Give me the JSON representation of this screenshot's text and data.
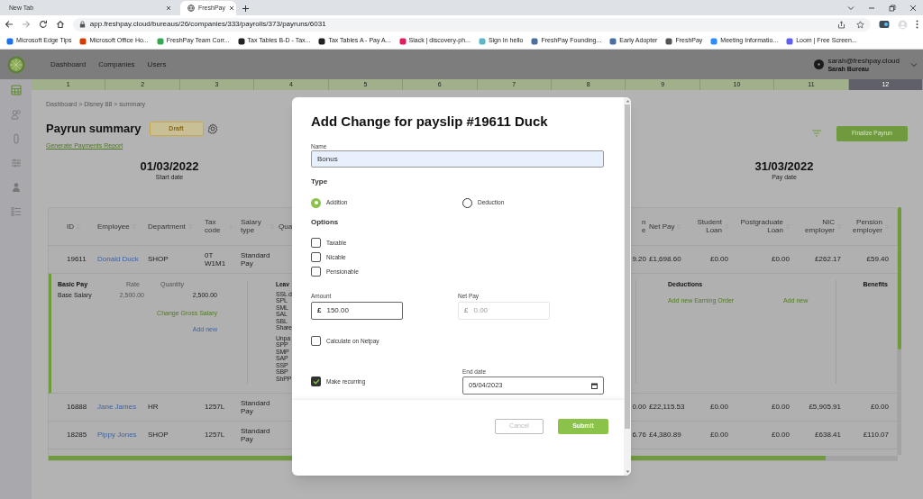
{
  "browser": {
    "tabs": [
      {
        "title": "New Tab",
        "selected": false
      },
      {
        "title": "FreshPay",
        "selected": true
      }
    ],
    "url": "app.freshpay.cloud/bureaus/26/companies/333/payrolls/373/payruns/6031",
    "bookmarks": [
      "Microsoft Edge Tips",
      "Microsoft Office Ho...",
      "FreshPay Team Corr...",
      "Tax Tables B-D - Tax...",
      "Tax Tables A - Pay A...",
      "Slack | discovery-ph...",
      "Sign In hello",
      "FreshPay Founding...",
      "Early Adopter",
      "FreshPay",
      "Meeting Informatio...",
      "Loom | Free Screen..."
    ]
  },
  "app": {
    "nav": [
      "Dashboard",
      "Companies",
      "Users"
    ],
    "user": {
      "email": "sarah@freshpay.cloud",
      "name": "Sarah Bureau"
    },
    "months": [
      {
        "label": "1",
        "selected": false
      },
      {
        "label": "2",
        "selected": false
      },
      {
        "label": "3",
        "selected": false
      },
      {
        "label": "4",
        "selected": false
      },
      {
        "label": "5",
        "selected": false
      },
      {
        "label": "6",
        "selected": false
      },
      {
        "label": "7",
        "selected": false
      },
      {
        "label": "8",
        "selected": false
      },
      {
        "label": "9",
        "selected": false
      },
      {
        "label": "10",
        "selected": false
      },
      {
        "label": "11",
        "selected": false
      },
      {
        "label": "12",
        "selected": true
      }
    ]
  },
  "page": {
    "breadcrumb": "Dashboard > Disney 88 > summary",
    "title": "Payrun summary",
    "status": "Draft",
    "report_link": "Generate Payments Report",
    "finalize_button": "Finalize Payrun",
    "start_date": {
      "value": "01/03/2022",
      "label": "Start date"
    },
    "pay_date": {
      "value": "31/03/2022",
      "label": "Pay date"
    }
  },
  "table": {
    "columns": [
      "ID",
      "Employee",
      "Department",
      "Tax code",
      "Salary type",
      "Qua",
      "n e",
      "Net Pay",
      "Student Loan",
      "Postgraduate Loan",
      "NIC employer",
      "Pension employer"
    ],
    "rows": [
      {
        "cells": [
          "19611",
          "Donald Duck",
          "SHOP",
          "0T W1M1",
          "Standard Pay",
          "",
          "9.20",
          "£1,698.60",
          "£0.00",
          "£0.00",
          "£262.17",
          "£59.40"
        ],
        "expanded": true
      },
      {
        "cells": [
          "16888",
          "Jane James",
          "HR",
          "1257L",
          "Standard Pay",
          "",
          "0.00",
          "£22,115.53",
          "£0.00",
          "£0.00",
          "£5,905.91",
          "£0.00"
        ],
        "expanded": false
      },
      {
        "cells": [
          "18285",
          "Pippy Jones",
          "SHOP",
          "1257L",
          "Standard Pay",
          "",
          "6.76",
          "£4,380.89",
          "£0.00",
          "£0.00",
          "£638.41",
          "£110.07"
        ],
        "expanded": false
      }
    ],
    "detail": {
      "basic_pay": {
        "title": "Basic Pay",
        "rate_label": "Rate",
        "quantity_label": "Quantity",
        "item": "Base Salary",
        "rate": "2,500.00",
        "quantity": "2,500.00",
        "change_link": "Change Gross Salary",
        "add_link": "Add new"
      },
      "leave": {
        "title": "Leav",
        "groups": [
          [
            "SSL d",
            "SPL",
            "SML",
            "SAL",
            "SBL",
            "Share"
          ],
          [
            "Unpa",
            "SPP",
            "SMP",
            "SAP",
            "SSP",
            "SBP",
            "ShPP"
          ]
        ]
      },
      "deductions": {
        "title": "Deductions",
        "earning_order_link": "Add new Earning Order",
        "add_link": "Add new"
      },
      "benefits": {
        "title": "Benefits"
      }
    }
  },
  "dialog": {
    "title": "Add Change for payslip #19611 Duck",
    "name_field": {
      "label": "Name",
      "value": "Bonus"
    },
    "type": {
      "label": "Type",
      "options": [
        {
          "label": "Addition",
          "selected": true
        },
        {
          "label": "Deduction",
          "selected": false
        }
      ]
    },
    "options": {
      "label": "Options",
      "items": [
        {
          "label": "Taxable",
          "checked": false
        },
        {
          "label": "Nicable",
          "checked": false
        },
        {
          "label": "Pensionable",
          "checked": false
        }
      ]
    },
    "amount": {
      "label": "Amount",
      "currency": "£",
      "value": "150.00",
      "disabled": false
    },
    "net_pay": {
      "label": "Net Pay",
      "currency": "£",
      "placeholder": "0.00",
      "disabled": true
    },
    "calculate_on_netpay": {
      "label": "Calculate on Netpay",
      "checked": false
    },
    "make_recurring": {
      "label": "Make recurring",
      "checked": true
    },
    "end_date": {
      "label": "End date",
      "value": "05/04/2023"
    },
    "cancel_button": "Cancel",
    "submit_button": "Submit"
  }
}
